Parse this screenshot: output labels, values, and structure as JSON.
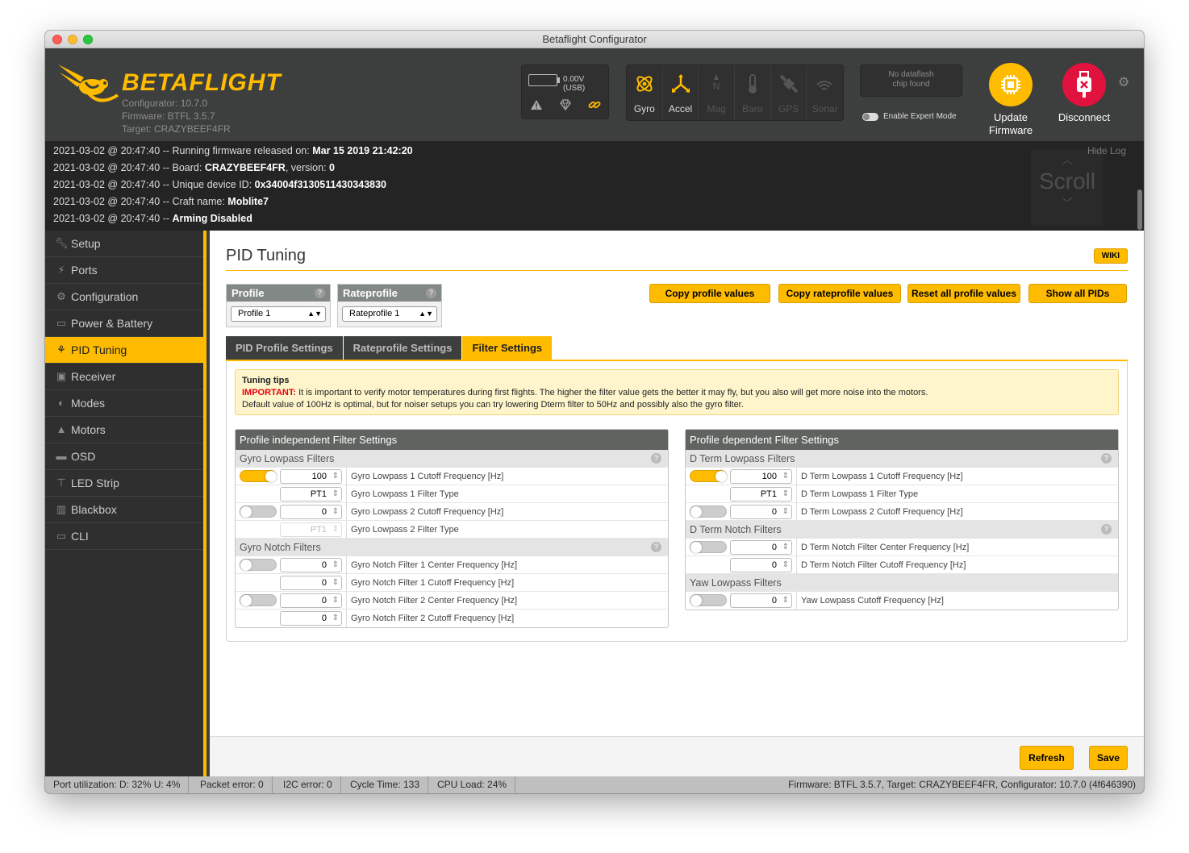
{
  "window": {
    "title": "Betaflight Configurator"
  },
  "header": {
    "logo": "BETAFLIGHT",
    "configurator_version": "Configurator: 10.7.0",
    "firmware": "Firmware: BTFL 3.5.7",
    "target": "Target: CRAZYBEEF4FR",
    "battery_voltage": "0.00V (USB)",
    "sensors": [
      {
        "label": "Gyro",
        "active": true,
        "icon": "gyro-icon"
      },
      {
        "label": "Accel",
        "active": true,
        "icon": "accel-icon"
      },
      {
        "label": "Mag",
        "active": false,
        "icon": "mag-icon"
      },
      {
        "label": "Baro",
        "active": false,
        "icon": "baro-icon"
      },
      {
        "label": "GPS",
        "active": false,
        "icon": "gps-icon"
      },
      {
        "label": "Sonar",
        "active": false,
        "icon": "sonar-icon"
      }
    ],
    "dataflash": "No dataflash chip found",
    "expert_mode": "Enable Expert Mode",
    "update_firmware_1": "Update",
    "update_firmware_2": "Firmware",
    "disconnect": "Disconnect"
  },
  "log": {
    "hide": "Hide Log",
    "scroll": "Scroll",
    "lines": [
      {
        "prefix": "2021-03-02 @ 20:47:40 -- Running firmware released on: ",
        "value": "Mar 15 2019 21:42:20",
        "suffix": ""
      },
      {
        "prefix": "2021-03-02 @ 20:47:40 -- Board: ",
        "value": "CRAZYBEEF4FR",
        "suffix": ", version: ",
        "value2": "0"
      },
      {
        "prefix": "2021-03-02 @ 20:47:40 -- Unique device ID: ",
        "value": "0x34004f3130511430343830",
        "suffix": ""
      },
      {
        "prefix": "2021-03-02 @ 20:47:40 -- Craft name: ",
        "value": "Moblite7",
        "suffix": ""
      },
      {
        "prefix": "2021-03-02 @ 20:47:40 -- ",
        "value": "Arming Disabled",
        "suffix": ""
      }
    ]
  },
  "sidebar": {
    "items": [
      {
        "label": "Setup",
        "icon": "wrench-icon"
      },
      {
        "label": "Ports",
        "icon": "plug-icon"
      },
      {
        "label": "Configuration",
        "icon": "gear-icon"
      },
      {
        "label": "Power & Battery",
        "icon": "battery-icon"
      },
      {
        "label": "PID Tuning",
        "icon": "pid-icon"
      },
      {
        "label": "Receiver",
        "icon": "receiver-icon"
      },
      {
        "label": "Modes",
        "icon": "modes-icon"
      },
      {
        "label": "Motors",
        "icon": "motor-icon"
      },
      {
        "label": "OSD",
        "icon": "osd-icon"
      },
      {
        "label": "LED Strip",
        "icon": "led-icon"
      },
      {
        "label": "Blackbox",
        "icon": "blackbox-icon"
      },
      {
        "label": "CLI",
        "icon": "cli-icon"
      }
    ],
    "active": "PID Tuning"
  },
  "main": {
    "title": "PID Tuning",
    "wiki": "WIKI",
    "profile": {
      "label": "Profile",
      "value": "Profile 1"
    },
    "rateprofile": {
      "label": "Rateprofile",
      "value": "Rateprofile 1"
    },
    "buttons": {
      "copy_profile": "Copy profile values",
      "copy_rateprofile": "Copy rateprofile values",
      "reset_all": "Reset all profile values",
      "show_all": "Show all PIDs"
    },
    "tabs": [
      "PID Profile Settings",
      "Rateprofile Settings",
      "Filter Settings"
    ],
    "active_tab": "Filter Settings",
    "tips": {
      "title": "Tuning tips",
      "important": "IMPORTANT:",
      "line1": " It is important to verify motor temperatures during first flights. The higher the filter value gets the better it may fly, but you also will get more noise into the motors.",
      "line2": "Default value of 100Hz is optimal, but for noiser setups you can try lowering Dterm filter to 50Hz and possibly also the gyro filter."
    },
    "left_panel": {
      "title": "Profile independent Filter Settings",
      "gyro_lowpass": {
        "title": "Gyro Lowpass Filters",
        "rows": [
          {
            "toggle": true,
            "value": "100",
            "label": "Gyro Lowpass 1 Cutoff Frequency [Hz]"
          },
          {
            "select": "PT1",
            "label": "Gyro Lowpass 1 Filter Type"
          },
          {
            "toggle": false,
            "value": "0",
            "label": "Gyro Lowpass 2 Cutoff Frequency [Hz]"
          },
          {
            "select": "PT1",
            "label": "Gyro Lowpass 2 Filter Type",
            "disabled": true
          }
        ]
      },
      "gyro_notch": {
        "title": "Gyro Notch Filters",
        "rows": [
          {
            "toggle": false,
            "value": "0",
            "label": "Gyro Notch Filter 1 Center Frequency [Hz]"
          },
          {
            "value": "0",
            "label": "Gyro Notch Filter 1 Cutoff Frequency [Hz]"
          },
          {
            "toggle": false,
            "value": "0",
            "label": "Gyro Notch Filter 2 Center Frequency [Hz]"
          },
          {
            "value": "0",
            "label": "Gyro Notch Filter 2 Cutoff Frequency [Hz]"
          }
        ]
      }
    },
    "right_panel": {
      "title": "Profile dependent Filter Settings",
      "dterm_lowpass": {
        "title": "D Term Lowpass Filters",
        "rows": [
          {
            "toggle": true,
            "value": "100",
            "label": "D Term Lowpass 1 Cutoff Frequency [Hz]"
          },
          {
            "select": "PT1",
            "label": "D Term Lowpass 1 Filter Type"
          },
          {
            "toggle": false,
            "value": "0",
            "label": "D Term Lowpass 2 Cutoff Frequency [Hz]"
          }
        ]
      },
      "dterm_notch": {
        "title": "D Term Notch Filters",
        "rows": [
          {
            "toggle": false,
            "value": "0",
            "label": "D Term Notch Filter Center Frequency [Hz]"
          },
          {
            "value": "0",
            "label": "D Term Notch Filter Cutoff Frequency [Hz]"
          }
        ]
      },
      "yaw_lowpass": {
        "title": "Yaw Lowpass Filters",
        "rows": [
          {
            "toggle": false,
            "value": "0",
            "label": "Yaw Lowpass Cutoff Frequency [Hz]"
          }
        ]
      }
    },
    "refresh": "Refresh",
    "save": "Save"
  },
  "status_bar": {
    "port_util": "Port utilization: D: 32% U: 4%",
    "packet_error": "Packet error: 0",
    "i2c_error": "I2C error: 0",
    "cycle_time": "Cycle Time: 133",
    "cpu_load": "CPU Load: 24%",
    "version": "Firmware: BTFL 3.5.7, Target: CRAZYBEEF4FR, Configurator: 10.7.0 (4f646390)"
  },
  "colors": {
    "accent": "#ffbb00",
    "important": "#e8000b",
    "disconnect": "#e2123f"
  }
}
